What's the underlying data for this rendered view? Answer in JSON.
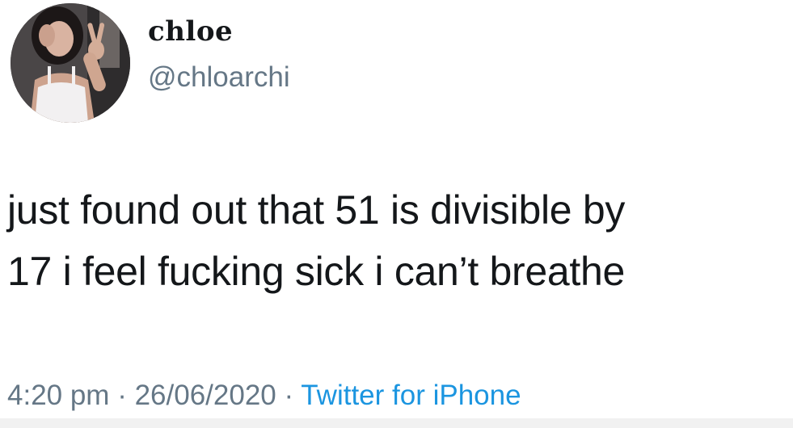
{
  "tweet": {
    "display_name": "chloe",
    "handle": "@chloarchi",
    "text_line_1": "just found out that 51 is divisible by",
    "text_line_2": "17 i feel fucking sick i can’t breathe",
    "time": "4:20 pm",
    "separator_1": " · ",
    "date": "26/06/2020",
    "separator_2": " · ",
    "source": "Twitter for iPhone"
  },
  "colors": {
    "text": "#14171a",
    "secondary": "#657786",
    "link": "#1b95e0",
    "background": "#ffffff"
  }
}
